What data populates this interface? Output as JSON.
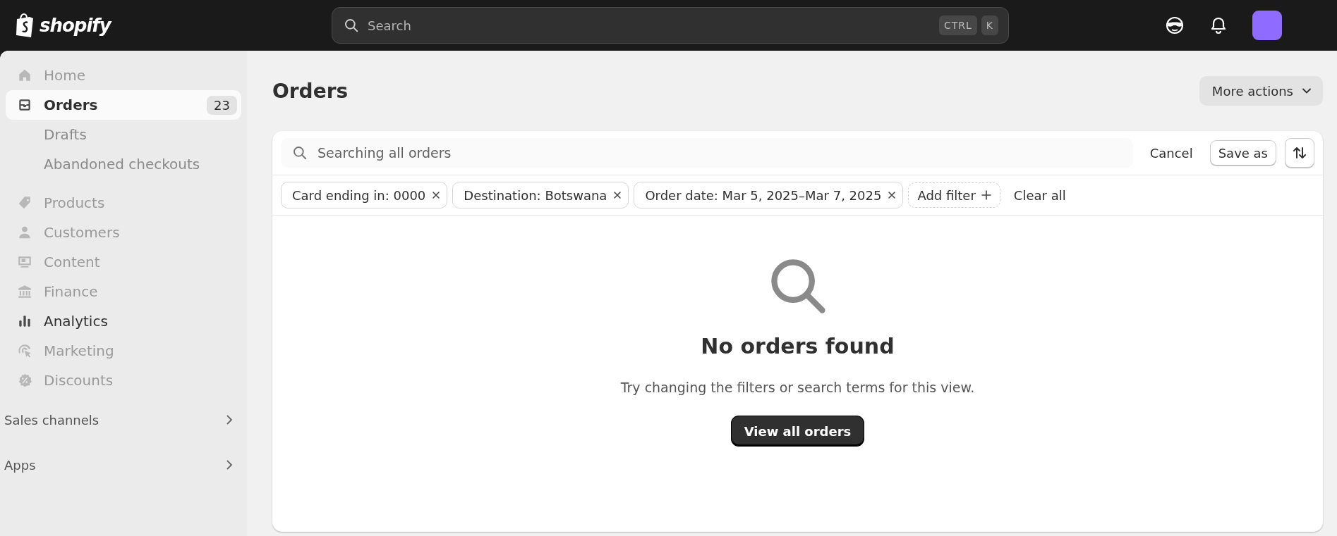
{
  "topbar": {
    "logo": "shopify",
    "search": {
      "placeholder": "Search"
    },
    "shortcut_keys": [
      "CTRL",
      "K"
    ]
  },
  "sidebar": {
    "items": [
      {
        "label": "Home",
        "selected": false,
        "disabled": true
      },
      {
        "label": "Orders",
        "selected": true,
        "disabled": false,
        "badge": "23",
        "children": [
          {
            "label": "Drafts",
            "selected": false
          },
          {
            "label": "Abandoned checkouts",
            "selected": false
          }
        ]
      },
      {
        "label": "Products",
        "selected": false,
        "disabled": true
      },
      {
        "label": "Customers",
        "selected": false,
        "disabled": true
      },
      {
        "label": "Content",
        "selected": false,
        "disabled": true
      },
      {
        "label": "Finance",
        "selected": false,
        "disabled": true
      },
      {
        "label": "Analytics",
        "selected": false,
        "disabled": false
      },
      {
        "label": "Marketing",
        "selected": false,
        "disabled": true
      },
      {
        "label": "Discounts",
        "selected": false,
        "disabled": true
      }
    ],
    "sections": [
      {
        "label": "Sales channels"
      },
      {
        "label": "Apps"
      }
    ]
  },
  "page": {
    "title": "Orders",
    "more_actions": "More actions",
    "search": {
      "placeholder": "Searching all orders"
    },
    "cancel": "Cancel",
    "save_as": "Save as",
    "filters": [
      {
        "label": "Card ending in: 0000"
      },
      {
        "label": "Destination: Botswana"
      },
      {
        "label": "Order date: Mar 5, 2025–Mar 7, 2025"
      }
    ],
    "add_filter": "Add filter",
    "clear_all": "Clear all",
    "empty_state": {
      "title": "No orders found",
      "description": "Try changing the filters or search terms for this view.",
      "button": "View all orders"
    }
  }
}
